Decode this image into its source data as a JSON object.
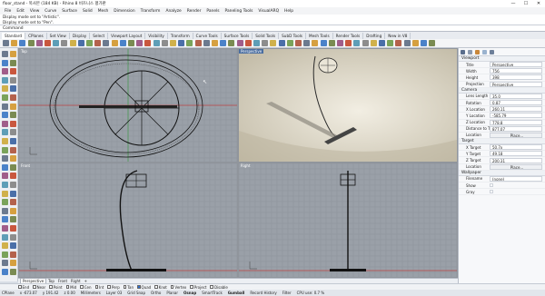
{
  "window": {
    "title": "floor_stand - 복사본 (184 KB) - Rhino 8 비즈니스 평가판",
    "controls": [
      "—",
      "☐",
      "✕"
    ]
  },
  "menu": [
    "File",
    "Edit",
    "View",
    "Curve",
    "Surface",
    "Solid",
    "Mesh",
    "Dimension",
    "Transform",
    "Analyze",
    "Render",
    "Panels",
    "Paneling Tools",
    "VisualARQ",
    "Help"
  ],
  "command_history": [
    "Display mode set to \"Artistic\".",
    "Display mode set to \"Pen\"."
  ],
  "command_prompt": "Command",
  "toolbar_tabs": [
    "Standard",
    "CPlanes",
    "Set View",
    "Display",
    "Select",
    "Viewport Layout",
    "Visibility",
    "Transform",
    "Curve Tools",
    "Surface Tools",
    "Solid Tools",
    "SubD Tools",
    "Mesh Tools",
    "Render Tools",
    "Drafting",
    "New in V8"
  ],
  "viewports": {
    "top": "Top",
    "perspective": "Perspective",
    "front": "Front",
    "right": "Right"
  },
  "viewport_tabs": [
    "Perspective",
    "Top",
    "Front",
    "Right"
  ],
  "osnaps": [
    {
      "label": "End",
      "on": false
    },
    {
      "label": "Near",
      "on": false
    },
    {
      "label": "Point",
      "on": false
    },
    {
      "label": "Mid",
      "on": false
    },
    {
      "label": "Cen",
      "on": false
    },
    {
      "label": "Int",
      "on": false
    },
    {
      "label": "Perp",
      "on": false
    },
    {
      "label": "Tan",
      "on": false
    },
    {
      "label": "Quad",
      "on": true
    },
    {
      "label": "Knot",
      "on": false
    },
    {
      "label": "Vertex",
      "on": false
    },
    {
      "label": "Project",
      "on": false
    },
    {
      "label": "Disable",
      "on": false
    }
  ],
  "status": {
    "cplane": "CPlane",
    "x": "x -673.07",
    "y": "y 191.42",
    "z": "z 0.00",
    "units": "Millimeters",
    "layer": "Layer 03",
    "toggles": [
      "Grid Snap",
      "Ortho",
      "Planar",
      "Osnap",
      "SmartTrack",
      "Gumball",
      "Record History",
      "Filter"
    ],
    "cpu": "CPU use: 0.7 %"
  },
  "properties": {
    "viewport_section": "Viewport",
    "viewport_rows": [
      {
        "k": "Title",
        "v": "Perspective"
      },
      {
        "k": "Width",
        "v": "756"
      },
      {
        "k": "Height",
        "v": "398"
      },
      {
        "k": "Projection",
        "v": "Perspective"
      }
    ],
    "camera_section": "Camera",
    "camera_rows": [
      {
        "k": "Lens Length",
        "v": "35.0"
      },
      {
        "k": "Rotation",
        "v": "0.87"
      },
      {
        "k": "X Location",
        "v": "260.11"
      },
      {
        "k": "Y Location",
        "v": "-585.79"
      },
      {
        "k": "Z Location",
        "v": "778.8"
      },
      {
        "k": "Distance to Target",
        "v": "877.07"
      },
      {
        "k": "Location",
        "v": "Place..."
      }
    ],
    "target_section": "Target",
    "target_rows": [
      {
        "k": "X Target",
        "v": "50.7x"
      },
      {
        "k": "Y Target",
        "v": "49.18"
      },
      {
        "k": "Z Target",
        "v": "200.31"
      },
      {
        "k": "Location",
        "v": "Place..."
      }
    ],
    "wallpaper_section": "Wallpaper",
    "wallpaper_rows": [
      {
        "k": "Filename",
        "v": "(none)"
      },
      {
        "k": "Show",
        "v": ""
      },
      {
        "k": "Gray",
        "v": ""
      }
    ]
  },
  "colors": {
    "viewport_grid_bg": "#9aa0a8",
    "grid_line": "#8a9098",
    "x_axis": "#b84040",
    "y_axis": "#3f9a48",
    "perspective_bg": "#cfc8b6",
    "accent": "#2f6fd0"
  }
}
